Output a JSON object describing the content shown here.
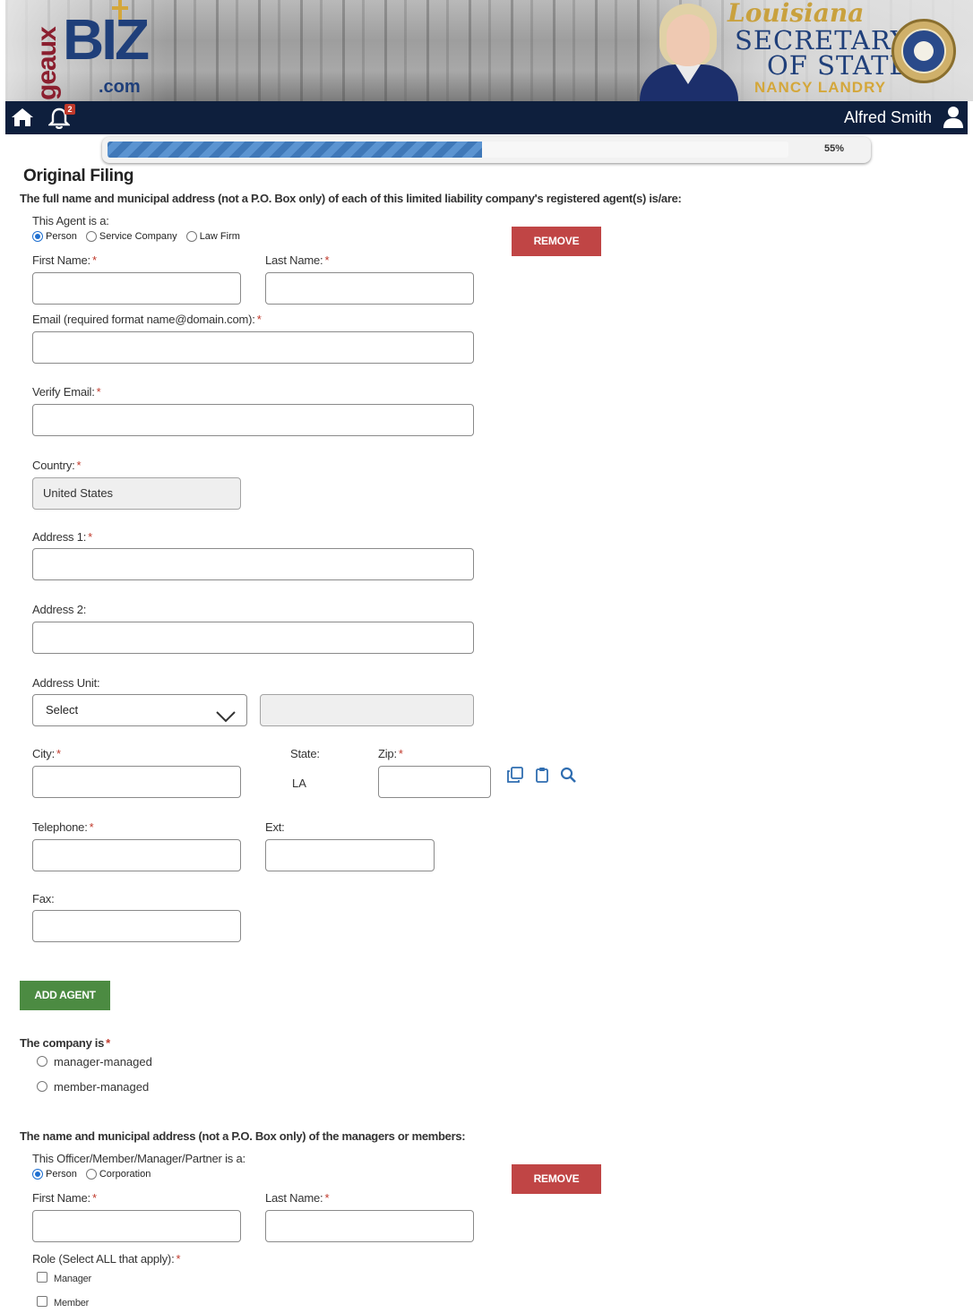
{
  "header": {
    "logo_geaux": "geaux",
    "logo_biz": "BIZ",
    "logo_com": ".com",
    "sos_state": "Louisiana",
    "sos_title_line1": "SECRETARY",
    "sos_title_line2": "OF STATE",
    "sos_name": "NANCY LANDRY"
  },
  "navbar": {
    "notification_count": "2",
    "user_name": "Alfred Smith"
  },
  "progress": {
    "percent": 55,
    "label": "55%"
  },
  "page": {
    "title": "Original Filing",
    "agent_intro": "The full name and municipal address (not a P.O. Box only) of each of this limited liability company's registered agent(s) is/are:"
  },
  "agent": {
    "type_label": "This Agent is a:",
    "type_options": [
      "Person",
      "Service Company",
      "Law Firm"
    ],
    "type_selected": "Person",
    "remove_label": "REMOVE",
    "first_name_label": "First Name:",
    "last_name_label": "Last Name:",
    "email_label": "Email (required format name@domain.com):",
    "verify_email_label": "Verify Email:",
    "country_label": "Country:",
    "country_value": "United States",
    "address1_label": "Address 1:",
    "address2_label": "Address 2:",
    "address_unit_label": "Address Unit:",
    "address_unit_value": "Select",
    "city_label": "City:",
    "state_label": "State:",
    "state_value": "LA",
    "zip_label": "Zip:",
    "telephone_label": "Telephone:",
    "ext_label": "Ext:",
    "fax_label": "Fax:",
    "required_mark": "*"
  },
  "add_agent_label": "ADD AGENT",
  "company": {
    "label": "The company is",
    "options": [
      "manager-managed",
      "member-managed"
    ]
  },
  "managers": {
    "intro": "The name and municipal address (not a P.O. Box only) of the managers or members:",
    "type_label": "This Officer/Member/Manager/Partner is a:",
    "type_options": [
      "Person",
      "Corporation"
    ],
    "type_selected": "Person",
    "remove_label": "REMOVE",
    "first_name_label": "First Name:",
    "last_name_label": "Last Name:",
    "role_label": "Role (Select ALL that apply):",
    "roles": [
      "Manager",
      "Member"
    ]
  },
  "icons": {
    "home": "home-icon",
    "bell": "bell-icon",
    "user": "user-icon",
    "copy": "copy-icon",
    "paste": "clipboard-icon",
    "search": "search-icon",
    "chevron": "chevron-down-icon"
  },
  "colors": {
    "nav_bg": "#0e1f3d",
    "remove_btn": "#c04545",
    "add_btn": "#4c8b42",
    "progress": "#3f78b8",
    "required": "#c0392b"
  }
}
